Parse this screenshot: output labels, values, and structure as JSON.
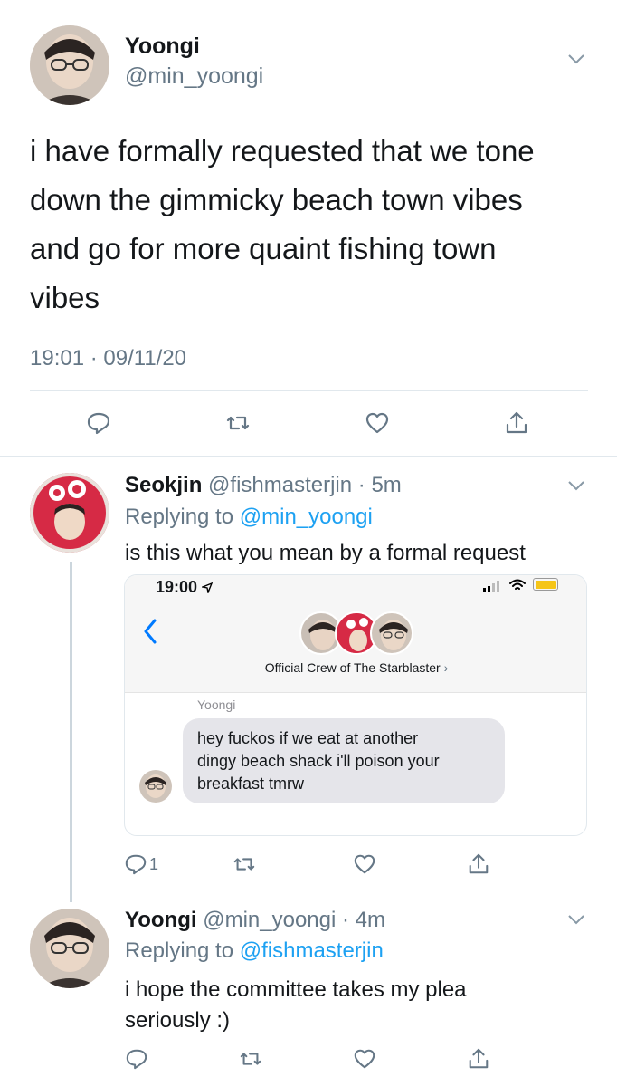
{
  "main_tweet": {
    "display_name": "Yoongi",
    "handle": "@min_yoongi",
    "text_lines": [
      "i have formally requested that we tone",
      "down the gimmicky beach town vibes",
      "and go for more quaint fishing town",
      "vibes"
    ],
    "timestamp": "19:01 · 09/11/20"
  },
  "reply_1": {
    "display_name": "Seokjin",
    "handle": "@fishmasterjin",
    "time": "· 5m",
    "replying_prefix": "Replying to",
    "replying_to": "@min_yoongi",
    "text": "is this what you mean by a formal request",
    "reply_count": "1",
    "embedded_screenshot": {
      "status_time": "19:00",
      "group_name": "Official Crew of The Starblaster",
      "group_chevron": "›",
      "sender_label": "Yoongi",
      "message_lines": [
        "hey fuckos if we eat at another",
        "dingy beach shack i'll poison your",
        "breakfast tmrw"
      ]
    }
  },
  "reply_2": {
    "display_name": "Yoongi",
    "handle": "@min_yoongi",
    "time": "· 4m",
    "replying_prefix": "Replying to",
    "replying_to": "@fishmasterjin",
    "text_lines": [
      "i hope the committee takes my plea",
      "seriously :)"
    ]
  },
  "colors": {
    "link_blue": "#1da1f2",
    "secondary_gray": "#657786",
    "imessage_blue": "#007aff",
    "bubble_gray": "#e5e5ea",
    "thread_line": "#ccd6dd"
  },
  "icons": [
    "reply-icon",
    "retweet-icon",
    "like-icon",
    "share-icon",
    "chevron-down-icon",
    "back-chevron-icon",
    "signal-icon",
    "wifi-icon",
    "battery-icon",
    "location-arrow-icon"
  ]
}
